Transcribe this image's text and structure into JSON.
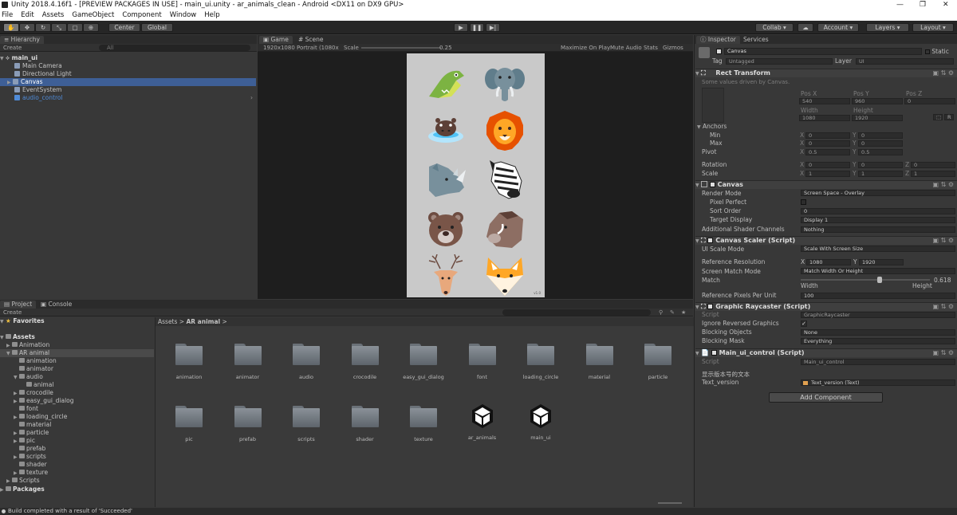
{
  "window": {
    "title": "Unity 2018.4.16f1 - [PREVIEW PACKAGES IN USE] - main_ui.unity - ar_animals_clean - Android <DX11 on DX9 GPU>"
  },
  "menu": [
    "File",
    "Edit",
    "Assets",
    "GameObject",
    "Component",
    "Window",
    "Help"
  ],
  "toolbar": {
    "center_label": "Center",
    "global_label": "Global",
    "collab_label": "Collab",
    "account_label": "Account",
    "layers_label": "Layers",
    "layout_label": "Layout"
  },
  "hierarchy": {
    "tab": "Hierarchy",
    "create": "Create",
    "search_placeholder": "All",
    "scene": "main_ui",
    "items": [
      "Main Camera",
      "Directional Light",
      "Canvas",
      "EventSystem",
      "audio_control"
    ]
  },
  "game": {
    "tab_game": "Game",
    "tab_scene": "Scene",
    "resolution": "1920x1080 Portrait (1080x",
    "scale_label": "Scale",
    "scale_value": "0.25",
    "maximize": "Maximize On Play",
    "mute": "Mute Audio",
    "stats": "Stats",
    "gizmos": "Gizmos",
    "version_label": "v1.0",
    "animals": [
      "crocodile",
      "elephant",
      "hippo",
      "lion",
      "rhino",
      "zebra",
      "bear",
      "boar",
      "deer",
      "fox"
    ]
  },
  "project": {
    "tab_project": "Project",
    "tab_console": "Console",
    "create": "Create",
    "favorites": "Favorites",
    "assets_root": "Assets",
    "breadcrumb": [
      "Assets",
      "AR animal"
    ],
    "tree": [
      {
        "label": "Animation",
        "depth": 1,
        "arrow": "closed"
      },
      {
        "label": "AR animal",
        "depth": 1,
        "arrow": "open"
      },
      {
        "label": "animation",
        "depth": 2,
        "arrow": "none"
      },
      {
        "label": "animator",
        "depth": 2,
        "arrow": "none"
      },
      {
        "label": "audio",
        "depth": 2,
        "arrow": "open"
      },
      {
        "label": "animal",
        "depth": 3,
        "arrow": "none"
      },
      {
        "label": "crocodile",
        "depth": 2,
        "arrow": "closed"
      },
      {
        "label": "easy_gui_dialog",
        "depth": 2,
        "arrow": "closed"
      },
      {
        "label": "font",
        "depth": 2,
        "arrow": "none"
      },
      {
        "label": "loading_circle",
        "depth": 2,
        "arrow": "closed"
      },
      {
        "label": "material",
        "depth": 2,
        "arrow": "none"
      },
      {
        "label": "particle",
        "depth": 2,
        "arrow": "closed"
      },
      {
        "label": "pic",
        "depth": 2,
        "arrow": "closed"
      },
      {
        "label": "prefab",
        "depth": 2,
        "arrow": "none"
      },
      {
        "label": "scripts",
        "depth": 2,
        "arrow": "closed"
      },
      {
        "label": "shader",
        "depth": 2,
        "arrow": "none"
      },
      {
        "label": "texture",
        "depth": 2,
        "arrow": "closed"
      },
      {
        "label": "Scripts",
        "depth": 1,
        "arrow": "closed"
      }
    ],
    "packages": "Packages",
    "assets": [
      {
        "label": "animation",
        "kind": "folder"
      },
      {
        "label": "animator",
        "kind": "folder"
      },
      {
        "label": "audio",
        "kind": "folder"
      },
      {
        "label": "crocodile",
        "kind": "folder"
      },
      {
        "label": "easy_gui_dialog",
        "kind": "folder"
      },
      {
        "label": "font",
        "kind": "folder"
      },
      {
        "label": "loading_circle",
        "kind": "folder"
      },
      {
        "label": "material",
        "kind": "folder"
      },
      {
        "label": "particle",
        "kind": "folder"
      },
      {
        "label": "pic",
        "kind": "folder"
      },
      {
        "label": "prefab",
        "kind": "folder"
      },
      {
        "label": "scripts",
        "kind": "folder"
      },
      {
        "label": "shader",
        "kind": "folder"
      },
      {
        "label": "texture",
        "kind": "folder"
      },
      {
        "label": "ar_animals",
        "kind": "unity"
      },
      {
        "label": "main_ui",
        "kind": "unity"
      }
    ]
  },
  "inspector": {
    "tab_inspector": "Inspector",
    "tab_services": "Services",
    "object_name": "Canvas",
    "static_label": "Static",
    "tag_label": "Tag",
    "tag_value": "Untagged",
    "layer_label": "Layer",
    "layer_value": "UI",
    "rect": {
      "title": "Rect Transform",
      "note": "Some values driven by Canvas.",
      "pos_x_label": "Pos X",
      "pos_y_label": "Pos Y",
      "pos_z_label": "Pos Z",
      "pos_x": "540",
      "pos_y": "960",
      "pos_z": "0",
      "width_label": "Width",
      "height_label": "Height",
      "width": "1080",
      "height": "1920",
      "anchors": "Anchors",
      "min": "Min",
      "max": "Max",
      "pivot": "Pivot",
      "rotation": "Rotation",
      "scale": "Scale",
      "anchor_min_x": "0",
      "anchor_min_y": "0",
      "anchor_max_x": "0",
      "anchor_max_y": "0",
      "pivot_x": "0.5",
      "pivot_y": "0.5",
      "rot_x": "0",
      "rot_y": "0",
      "rot_z": "0",
      "scale_x": "1",
      "scale_y": "1",
      "scale_z": "1",
      "x": "X",
      "y": "Y",
      "z": "Z",
      "r": "R"
    },
    "canvas": {
      "title": "Canvas",
      "render_mode_label": "Render Mode",
      "render_mode": "Screen Space - Overlay",
      "pixel_perfect": "Pixel Perfect",
      "sort_order_label": "Sort Order",
      "sort_order": "0",
      "target_display_label": "Target Display",
      "target_display": "Display 1",
      "shader_channels_label": "Additional Shader Channels",
      "shader_channels": "Nothing"
    },
    "scaler": {
      "title": "Canvas Scaler (Script)",
      "ui_scale_mode_label": "UI Scale Mode",
      "ui_scale_mode": "Scale With Screen Size",
      "ref_res_label": "Reference Resolution",
      "ref_x": "1080",
      "ref_y": "1920",
      "match_mode_label": "Screen Match Mode",
      "match_mode": "Match Width Or Height",
      "match_label": "Match",
      "match_value": "0.618",
      "width_label": "Width",
      "height_label": "Height",
      "ppu_label": "Reference Pixels Per Unit",
      "ppu": "100"
    },
    "raycaster": {
      "title": "Graphic Raycaster (Script)",
      "script_label": "Script",
      "script": "GraphicRaycaster",
      "ignore_label": "Ignore Reversed Graphics",
      "blocking_objects_label": "Blocking Objects",
      "blocking_objects": "None",
      "blocking_mask_label": "Blocking Mask",
      "blocking_mask": "Everything"
    },
    "mainui": {
      "title": "Main_ui_control (Script)",
      "script_label": "Script",
      "script": "Main_ui_control",
      "cn_label": "显示版本号的文本",
      "text_version_label": "Text_version",
      "text_version": "Text_version (Text)"
    },
    "add_component": "Add Component"
  },
  "status": "Build completed with a result of 'Succeeded'"
}
